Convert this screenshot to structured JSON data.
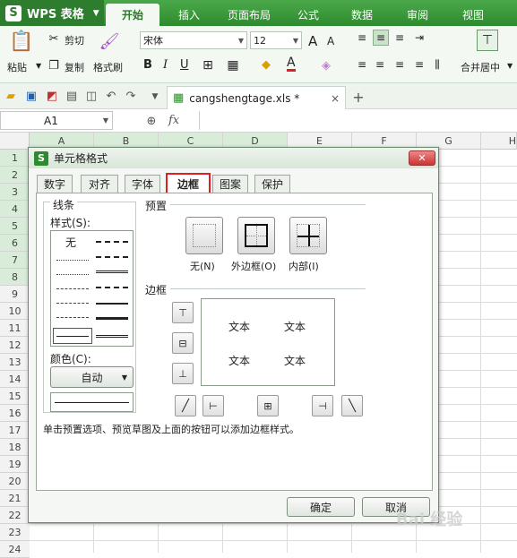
{
  "app": {
    "name": "WPS 表格",
    "logo": "S"
  },
  "tabs": [
    "开始",
    "插入",
    "页面布局",
    "公式",
    "数据",
    "审阅",
    "视图"
  ],
  "ribbon": {
    "paste": "粘贴",
    "cut": "剪切",
    "copy": "复制",
    "format_painter": "格式刷",
    "font_name": "宋体",
    "font_size": "12",
    "merge": "合并居中",
    "bold": "B",
    "italic": "I",
    "underline": "U",
    "grow": "A",
    "shrink": "A",
    "font_color": "A"
  },
  "file": {
    "name": "cangshengtage.xls *"
  },
  "formula_bar": {
    "cell": "A1",
    "fx": "fx"
  },
  "columns": [
    "A",
    "B",
    "C",
    "D",
    "E",
    "F",
    "G",
    "H"
  ],
  "rows": [
    "1",
    "2",
    "3",
    "4",
    "5",
    "6",
    "7",
    "8",
    "9",
    "10",
    "11",
    "12",
    "13",
    "14",
    "15",
    "16",
    "17",
    "18",
    "19",
    "20",
    "21",
    "22",
    "23",
    "24"
  ],
  "dialog": {
    "title": "单元格格式",
    "tabs": [
      "数字",
      "对齐",
      "字体",
      "边框",
      "图案",
      "保护"
    ],
    "line_group": "线条",
    "style_label": "样式(S):",
    "none_style": "无",
    "color_label": "颜色(C):",
    "color_value": "自动",
    "preset_label": "预置",
    "presets": [
      "无(N)",
      "外边框(O)",
      "内部(I)"
    ],
    "border_label": "边框",
    "preview_text": [
      "文本",
      "文本",
      "文本",
      "文本"
    ],
    "hint": "单击预置选项、预览草图及上面的按钮可以添加边框样式。",
    "ok": "确定",
    "cancel": "取消"
  },
  "watermark": "Bai 经验"
}
